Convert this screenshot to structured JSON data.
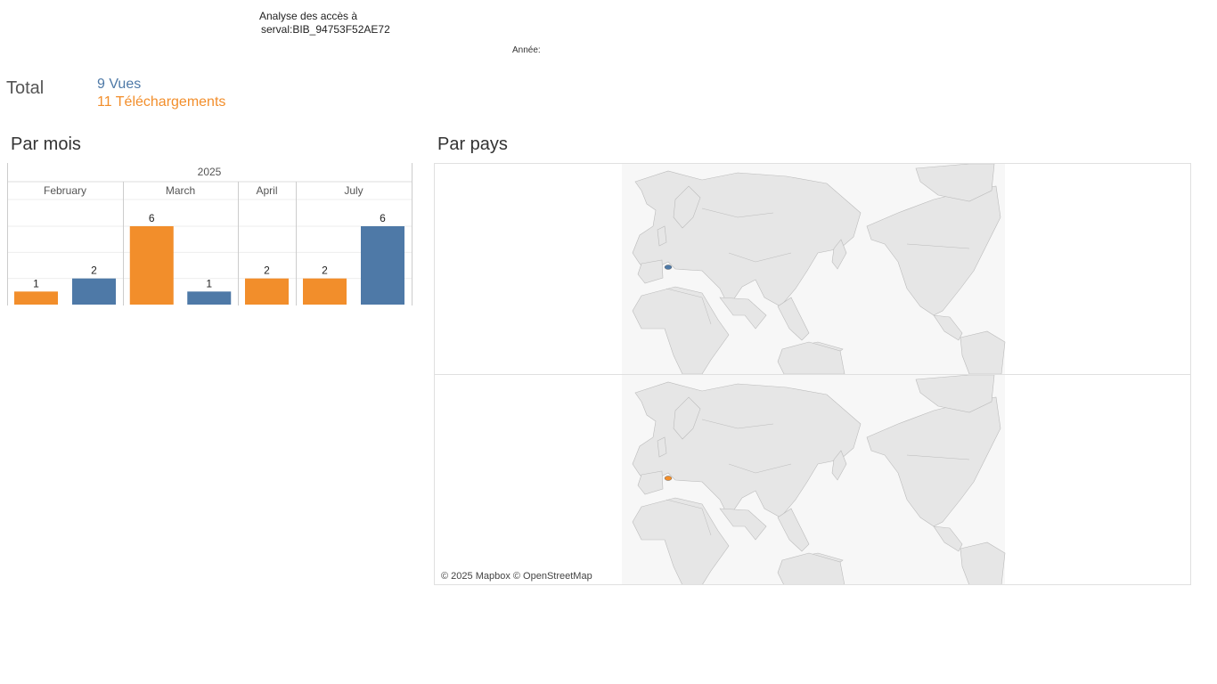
{
  "header": {
    "title_line1": "Analyse des accès à",
    "title_line2": "serval:BIB_94753F52AE72",
    "year_filter_label": "Année:"
  },
  "totals": {
    "label": "Total",
    "views": "9 Vues",
    "downloads": "11 Téléchargements"
  },
  "colors": {
    "views": "#4e79a7",
    "downloads": "#f28e2b",
    "land": "#e6e6e6",
    "borders": "#bbbbbb"
  },
  "sections": {
    "by_month": "Par mois",
    "by_country": "Par pays"
  },
  "chart_data": {
    "type": "bar",
    "year_label": "2025",
    "categories": [
      "February",
      "March",
      "April",
      "July"
    ],
    "series": [
      {
        "name": "Téléchargements",
        "color": "#f28e2b",
        "values": [
          1,
          6,
          2,
          2
        ]
      },
      {
        "name": "Vues",
        "color": "#4e79a7",
        "values": [
          2,
          1,
          null,
          6
        ]
      }
    ],
    "ylim": [
      0,
      7
    ],
    "grid": true
  },
  "map": {
    "panels": [
      {
        "series": "Vues",
        "highlight_color": "#4e79a7"
      },
      {
        "series": "Téléchargements",
        "highlight_color": "#f28e2b"
      }
    ],
    "attribution": "© 2025 Mapbox © OpenStreetMap"
  }
}
